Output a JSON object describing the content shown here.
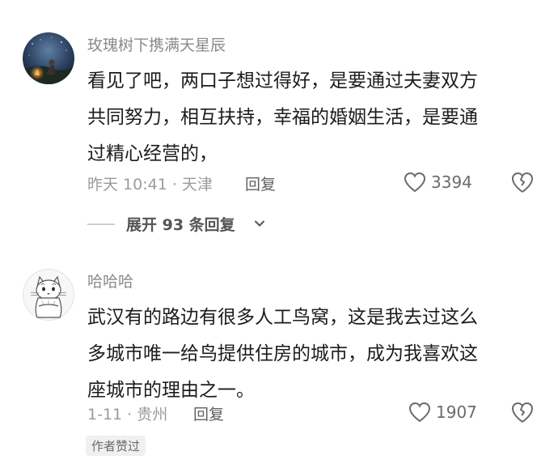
{
  "comments": [
    {
      "username": "玫瑰树下携满天星辰",
      "lines": [
        "看见了吧，两口子想过得好，是要通过夫妻双方",
        "共同努力，相互扶持，幸福的婚姻生活，是要通",
        "过精心经营的，"
      ],
      "meta": "昨天 10:41 · 天津",
      "reply_label": "回复",
      "likes": "3394",
      "replies_label": "展开 93 条回复"
    },
    {
      "username": "哈哈哈",
      "lines": [
        "武汉有的路边有很多人工鸟窝，这是我去过这么",
        "多城市唯一给鸟提供住房的城市，成为我喜欢这",
        "座城市的理由之一。"
      ],
      "meta": "1-11 · 贵州",
      "reply_label": "回复",
      "likes": "1907",
      "badge": "作者赞过"
    }
  ],
  "colors": {
    "username": "#8a8a8a",
    "body": "#1c1c1c",
    "meta": "#9b9b9b",
    "icon_stroke": "#6b6b6b"
  },
  "icons": {
    "like": "heart-outline-icon",
    "dislike": "broken-heart-icon",
    "expand": "chevron-down-icon"
  }
}
